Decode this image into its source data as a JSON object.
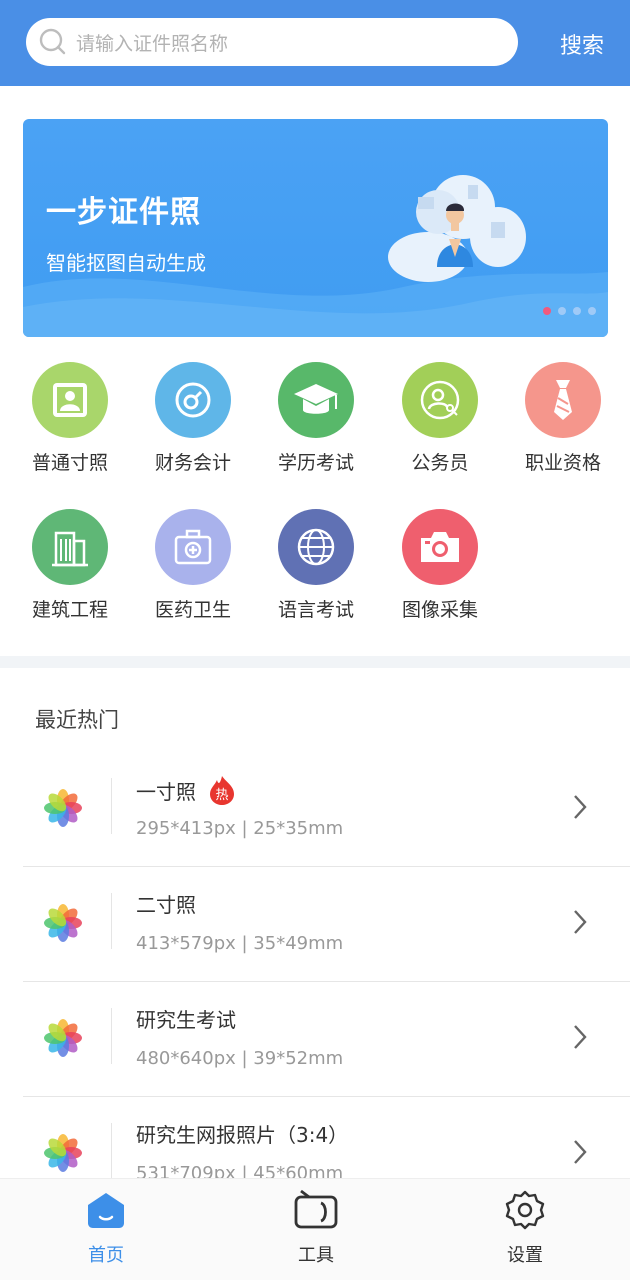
{
  "search": {
    "placeholder": "请输入证件照名称",
    "button_label": "搜索"
  },
  "banner": {
    "title": "一步证件照",
    "subtitle": "智能抠图自动生成",
    "page_count": 4,
    "active_page": 1
  },
  "categories": [
    {
      "label": "普通寸照",
      "icon": "id-card-icon",
      "color": "#a9d66b"
    },
    {
      "label": "财务会计",
      "icon": "finance-icon",
      "color": "#5fb6e8"
    },
    {
      "label": "学历考试",
      "icon": "graduation-cap-icon",
      "color": "#58b86a"
    },
    {
      "label": "公务员",
      "icon": "user-key-icon",
      "color": "#a2cf58"
    },
    {
      "label": "职业资格",
      "icon": "tie-icon",
      "color": "#f5968c"
    },
    {
      "label": "建筑工程",
      "icon": "building-icon",
      "color": "#5fb776"
    },
    {
      "label": "医药卫生",
      "icon": "medical-kit-icon",
      "color": "#a9b2ec"
    },
    {
      "label": "语言考试",
      "icon": "globe-icon",
      "color": "#6071b4"
    },
    {
      "label": "图像采集",
      "icon": "camera-icon",
      "color": "#ef5f6e"
    }
  ],
  "recent": {
    "title": "最近热门",
    "items": [
      {
        "name": "一寸照",
        "hot_label": "热",
        "dims": "295*413px  |  25*35mm"
      },
      {
        "name": "二寸照",
        "hot_label": "",
        "dims": "413*579px  |  35*49mm"
      },
      {
        "name": "研究生考试",
        "hot_label": "",
        "dims": "480*640px  |  39*52mm"
      },
      {
        "name": "研究生网报照片（3:4）",
        "hot_label": "",
        "dims": "531*709px  |  45*60mm"
      }
    ]
  },
  "nav": {
    "tabs": [
      {
        "label": "首页",
        "icon": "home-icon",
        "active": true
      },
      {
        "label": "工具",
        "icon": "tools-icon",
        "active": false
      },
      {
        "label": "设置",
        "icon": "settings-gear-icon",
        "active": false
      }
    ],
    "active_color": "#3d8fe8",
    "inactive_color": "#333333"
  }
}
